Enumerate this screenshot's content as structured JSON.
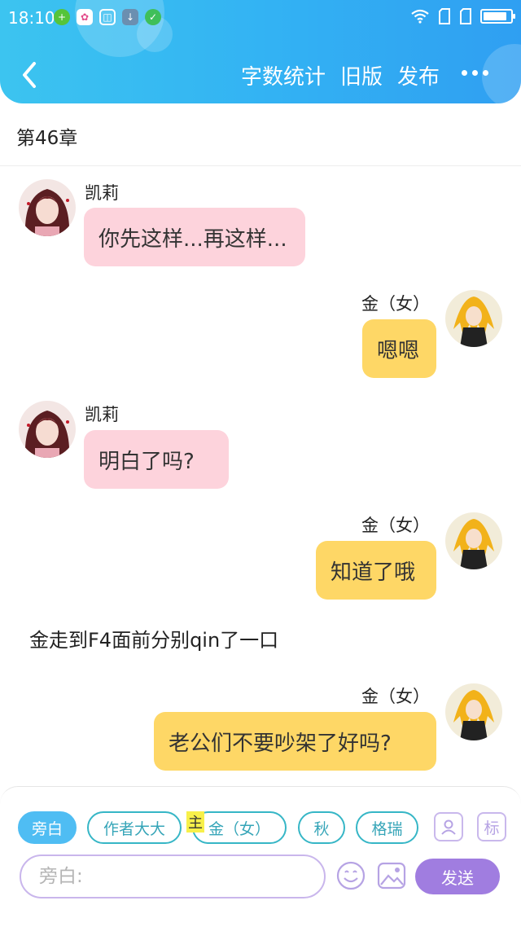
{
  "status_bar": {
    "time": "18:10"
  },
  "header": {
    "back_label": "back",
    "actions": [
      "字数统计",
      "旧版",
      "发布"
    ]
  },
  "chapter": {
    "title": "第46章"
  },
  "messages": [
    {
      "speaker": "凯莉",
      "text": "你先这样...再这样..."
    },
    {
      "speaker": "金（女）",
      "text": "嗯嗯"
    },
    {
      "speaker": "凯莉",
      "text": "明白了吗?"
    },
    {
      "speaker": "金（女）",
      "text": "知道了哦"
    },
    {
      "speaker": "金（女）",
      "text": "老公们不要吵架了好吗?"
    }
  ],
  "narration": "金走到F4面前分别qin了一口",
  "composer": {
    "roles": [
      "旁白",
      "作者大大",
      "金（女）",
      "秋",
      "格瑞"
    ],
    "active_role_index": 0,
    "main_tag": "主",
    "tag_button": "标",
    "input_placeholder": "旁白:",
    "send_label": "发送"
  },
  "colors": {
    "header_blue": "#33b3f3",
    "bubble_pink": "#fdd3dc",
    "bubble_yellow": "#fed766",
    "accent_purple": "#a07de0",
    "chip_teal": "#36b6c6"
  }
}
